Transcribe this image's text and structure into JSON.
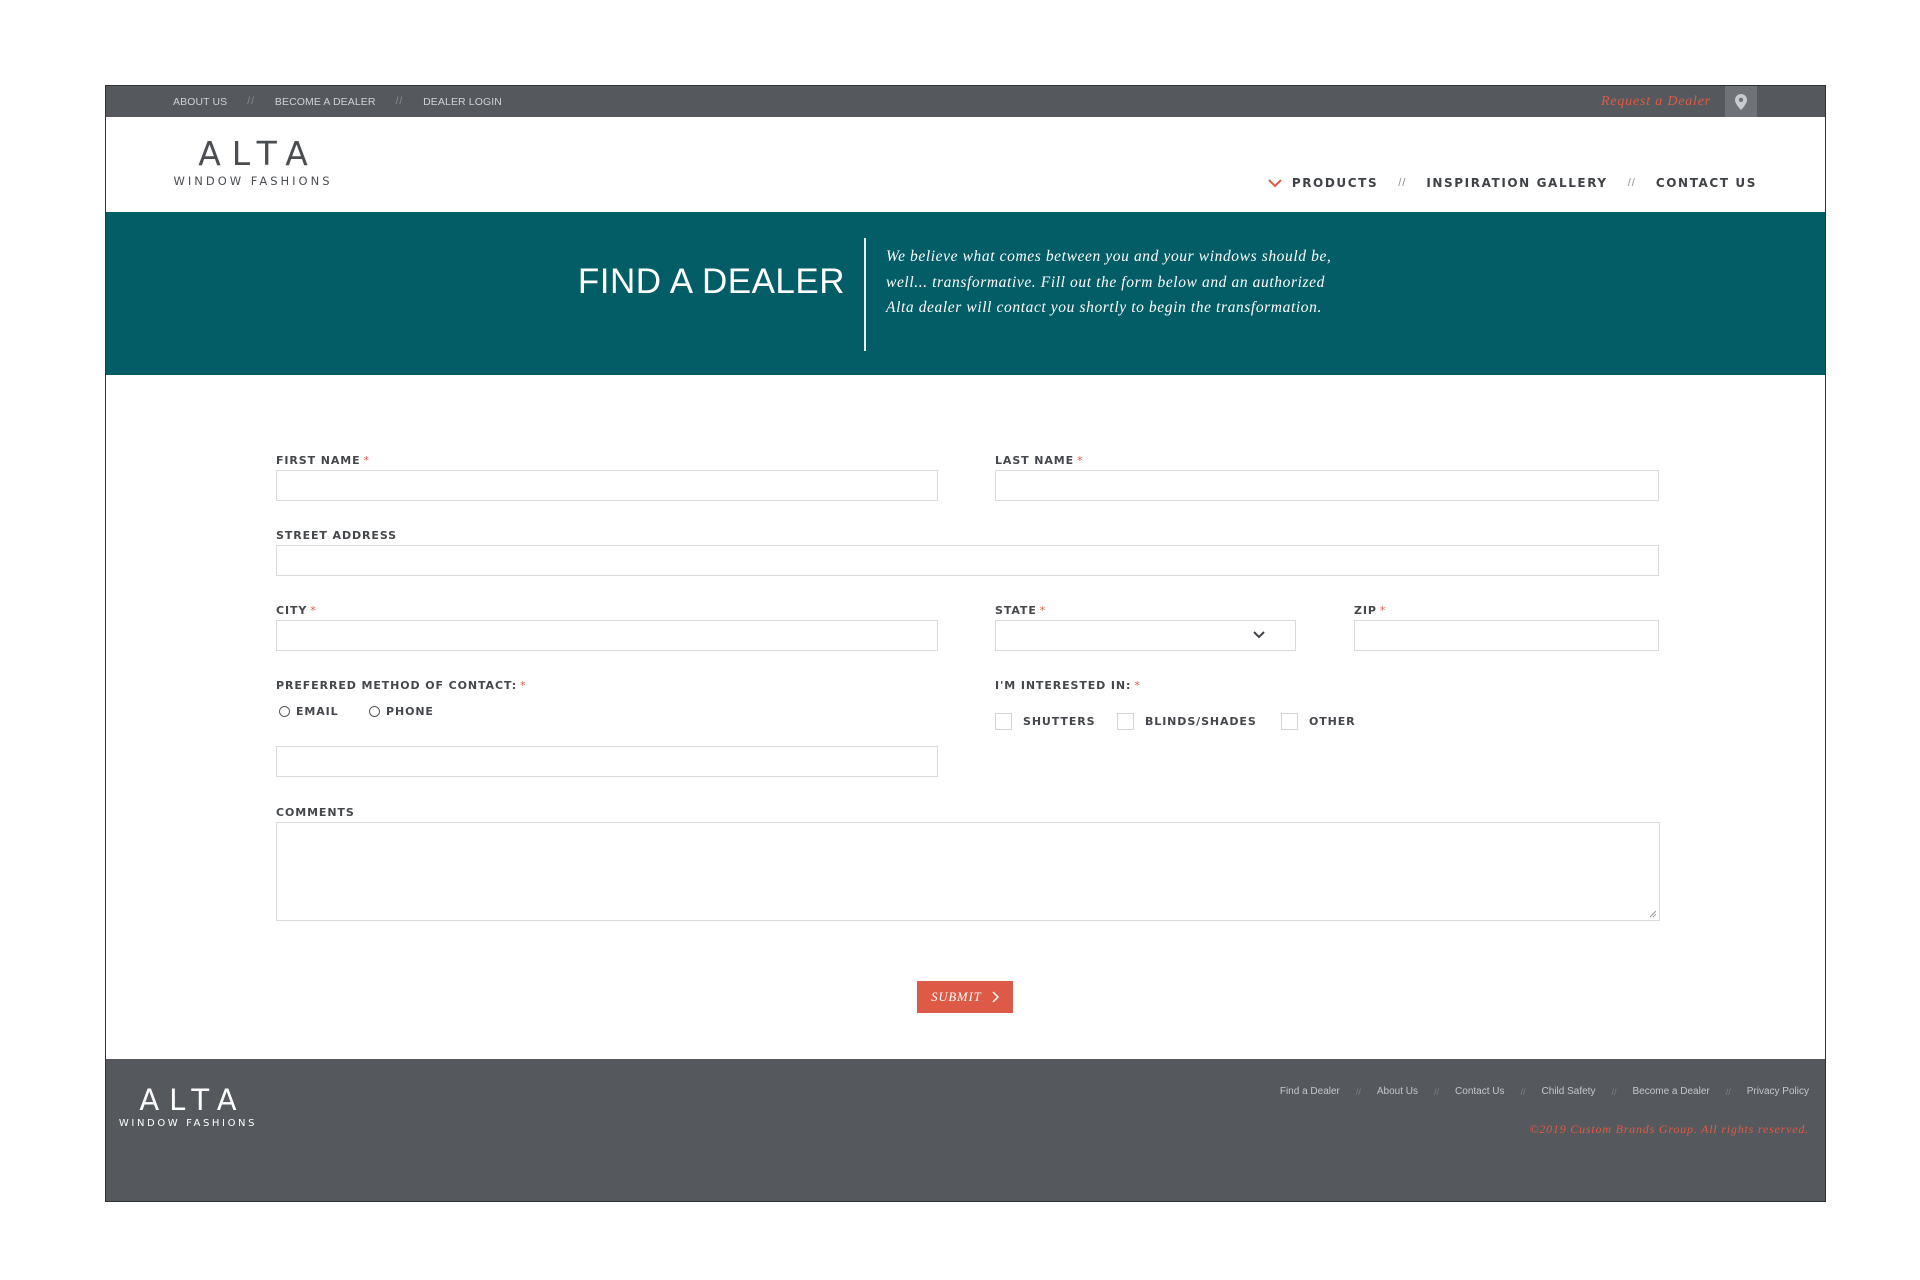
{
  "topbar": {
    "links": [
      "ABOUT US",
      "BECOME A DEALER",
      "DEALER LOGIN"
    ],
    "separator": "//",
    "request_dealer": "Request a Dealer",
    "pin_icon": "map-pin-icon"
  },
  "brand": {
    "name": "ALTA",
    "tagline": "WINDOW FASHIONS"
  },
  "nav": {
    "items": [
      "PRODUCTS",
      "INSPIRATION GALLERY",
      "CONTACT US"
    ],
    "separator": "//",
    "products_icon": "chevron-down-icon"
  },
  "hero": {
    "title": "FIND A DEALER",
    "text": "We believe what comes between you and your windows should be, well... transformative. Fill out the form below and an authorized Alta dealer will contact you shortly to begin the transformation."
  },
  "form": {
    "required_mark": "*",
    "first_name_label": "FIRST NAME",
    "last_name_label": "LAST NAME",
    "street_label": "STREET ADDRESS",
    "city_label": "CITY",
    "state_label": "STATE",
    "zip_label": "ZIP",
    "contact_label": "PREFERRED METHOD OF CONTACT:",
    "contact_options": [
      "EMAIL",
      "PHONE"
    ],
    "interest_label": "I'M INTERESTED IN:",
    "interest_options": [
      "SHUTTERS",
      "BLINDS/SHADES",
      "OTHER"
    ],
    "comments_label": "COMMENTS",
    "submit_label": "SUBMIT"
  },
  "footer": {
    "links": [
      "Find a Dealer",
      "About Us",
      "Contact Us",
      "Child Safety",
      "Become a Dealer",
      "Privacy Policy"
    ],
    "separator": "//",
    "copyright": "©2019 Custom Brands Group. All rights reserved."
  },
  "colors": {
    "accent": "#e05a43",
    "hero_bg": "#035d66",
    "bar_bg": "#55595d"
  }
}
